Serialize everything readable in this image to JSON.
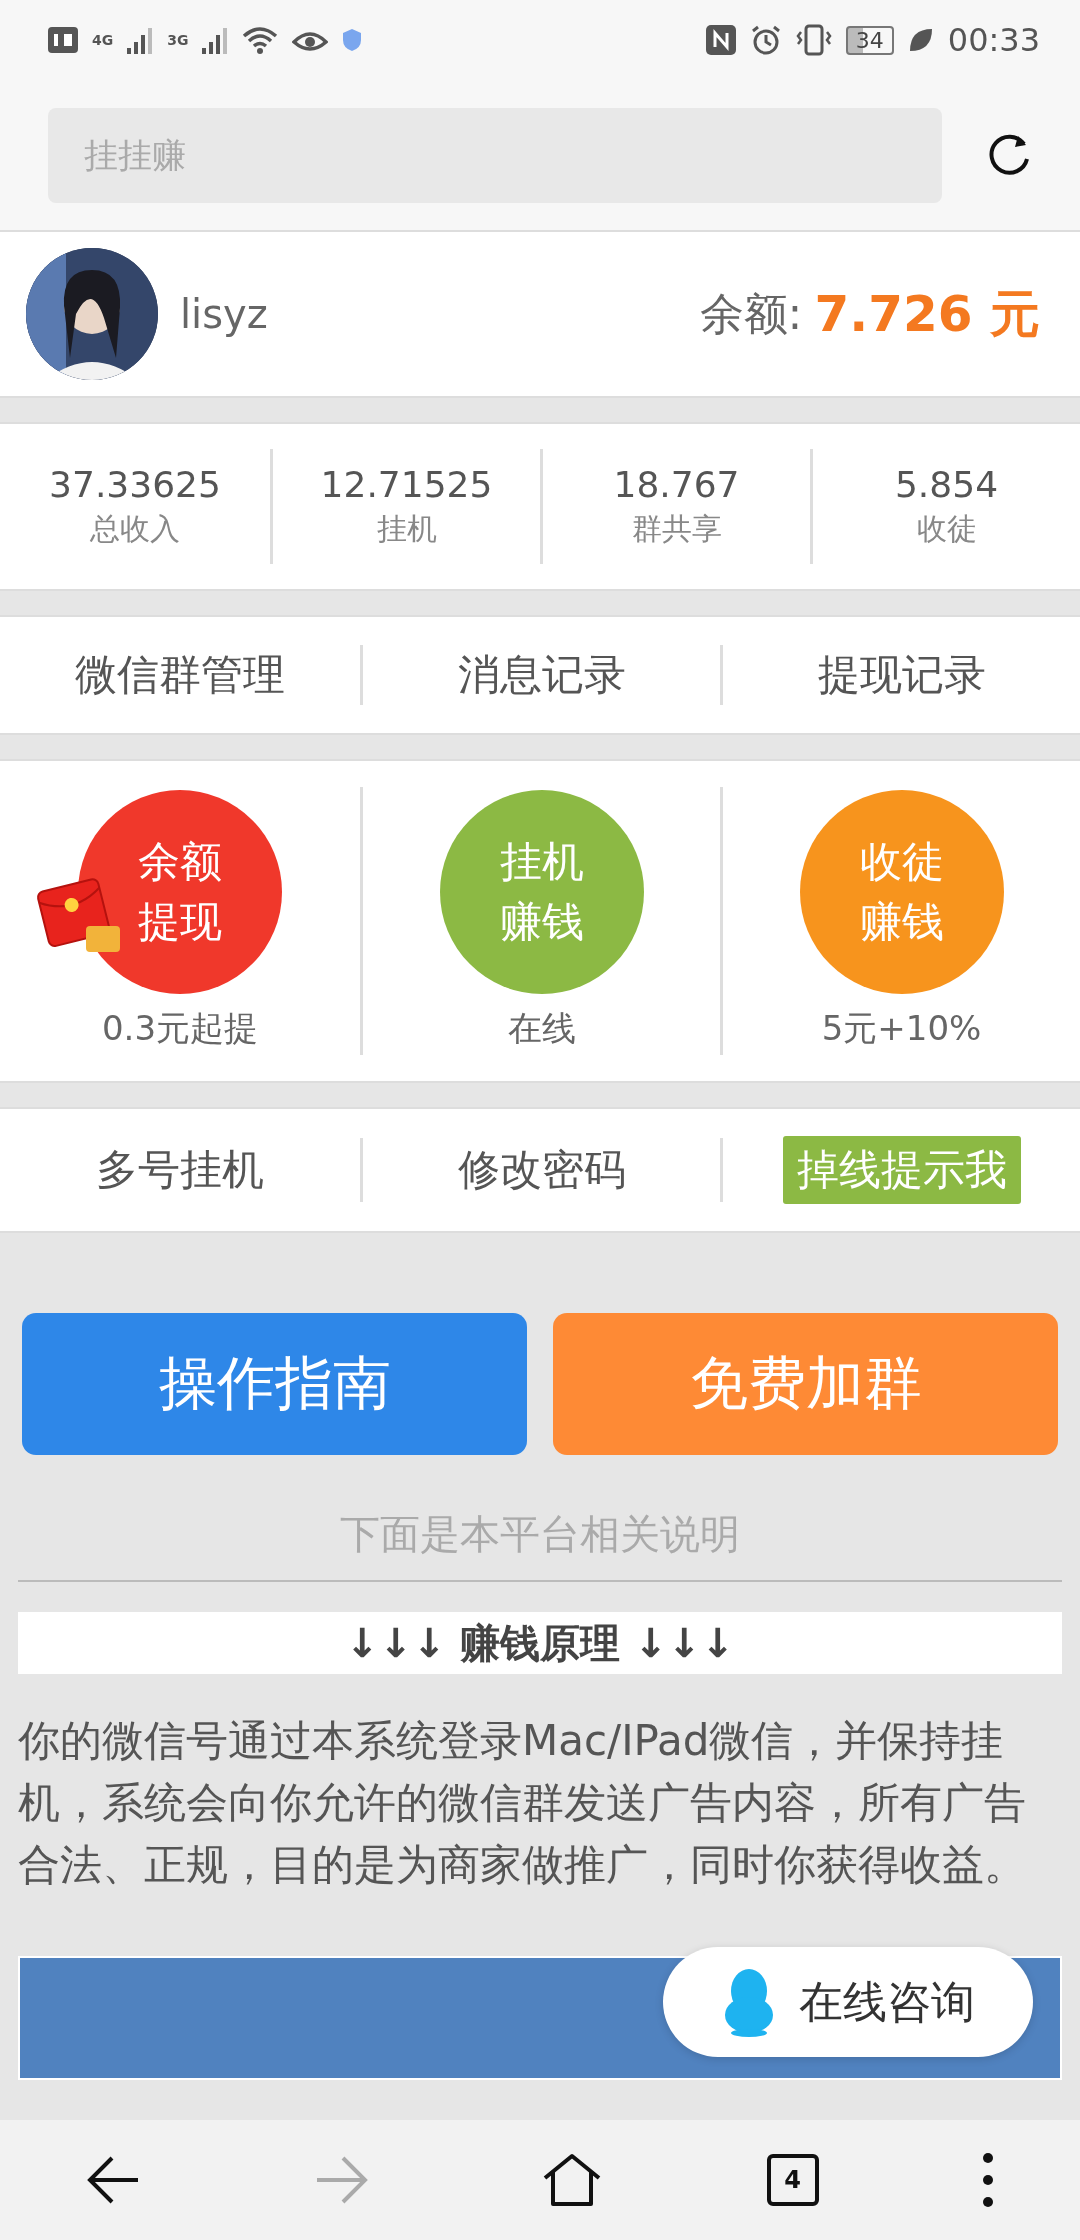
{
  "status_bar": {
    "network_1": "4G",
    "network_2": "3G",
    "battery": "34",
    "time": "00:33"
  },
  "search": {
    "placeholder": "挂挂赚"
  },
  "profile": {
    "username": "lisyz",
    "balance_label": "余额:",
    "balance_value": "7.726 元"
  },
  "stats": [
    {
      "value": "37.33625",
      "label": "总收入"
    },
    {
      "value": "12.71525",
      "label": "挂机"
    },
    {
      "value": "18.767",
      "label": "群共享"
    },
    {
      "value": "5.854",
      "label": "收徒"
    }
  ],
  "records": [
    "微信群管理",
    "消息记录",
    "提现记录"
  ],
  "features": [
    {
      "kind": "envelope",
      "line_1": "余额",
      "line_2": "提现",
      "caption": "0.3元起提",
      "color": "#f0382b"
    },
    {
      "kind": "plain",
      "line_1": "挂机",
      "line_2": "赚钱",
      "caption": "在线",
      "color": "#8cb944"
    },
    {
      "kind": "plain",
      "line_1": "收徒",
      "line_2": "赚钱",
      "caption": "5元+10%",
      "color": "#f7941d"
    }
  ],
  "options": [
    {
      "label": "多号挂机",
      "on": false
    },
    {
      "label": "修改密码",
      "on": false
    },
    {
      "label": "掉线提示我",
      "on": true
    }
  ],
  "big_buttons": [
    {
      "label": "操作指南",
      "color": "#2e87e8"
    },
    {
      "label": "免费加群",
      "color": "#fe8a35"
    }
  ],
  "note": "下面是本平台相关说明",
  "section_title": "↓↓↓ 赚钱原理 ↓↓↓",
  "paragraph": "你的微信号通过本系统登录Mac/IPad微信，并保持挂机，系统会向你允许的微信群发送广告内容，所有广告合法、正规，目的是为商家做推广，同时你获得收益。",
  "consult": {
    "label": "在线咨询"
  },
  "nav": {
    "tabs_count": "4"
  }
}
